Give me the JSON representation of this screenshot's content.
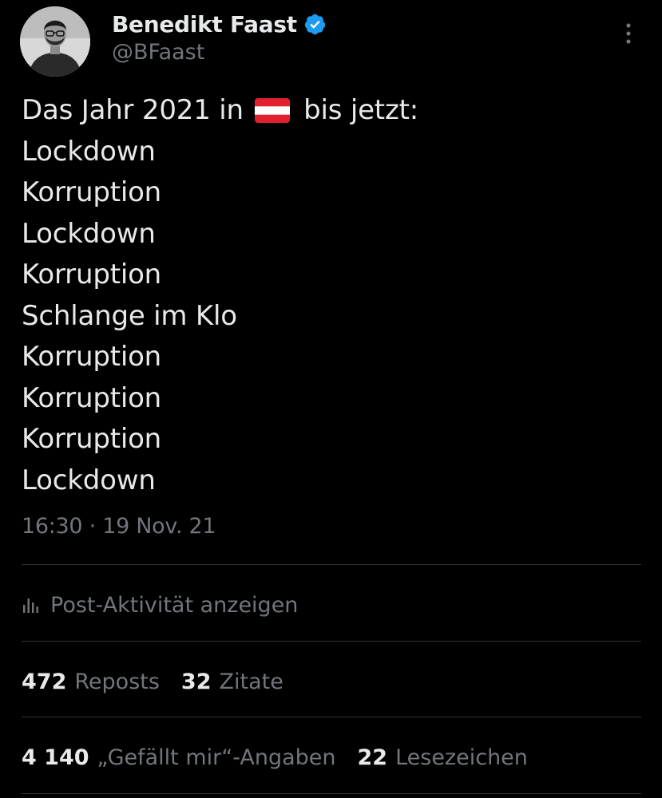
{
  "author": {
    "name": "Benedikt Faast",
    "handle": "@BFaast",
    "verified_icon": "verified-badge-icon",
    "avatar_icon": "avatar-photo"
  },
  "menu": {
    "icon": "more-vertical-icon"
  },
  "tweet": {
    "first_line_before": "Das Jahr 2021 in",
    "flag_icon": "austria-flag-icon",
    "first_line_after": "bis jetzt:",
    "lines": [
      "Lockdown",
      "Korruption",
      "Lockdown",
      "Korruption",
      "Schlange im Klo",
      "Korruption",
      "Korruption",
      "Korruption",
      "Lockdown"
    ]
  },
  "meta": {
    "time": "16:30",
    "separator": "·",
    "date": "19 Nov. 21"
  },
  "activity": {
    "icon": "bar-chart-icon",
    "label": "Post-Aktivität anzeigen"
  },
  "stats": {
    "reposts_count": "472",
    "reposts_label": "Reposts",
    "quotes_count": "32",
    "quotes_label": "Zitate",
    "likes_count": "4 140",
    "likes_label": "„Gefällt mir“-Angaben",
    "bookmarks_count": "22",
    "bookmarks_label": "Lesezeichen"
  },
  "colors": {
    "background": "#000000",
    "text": "#e7e9ea",
    "secondary": "#71767b",
    "divider": "#2f3336",
    "verified": "#1d9bf0",
    "flag_red": "#e0202e"
  }
}
